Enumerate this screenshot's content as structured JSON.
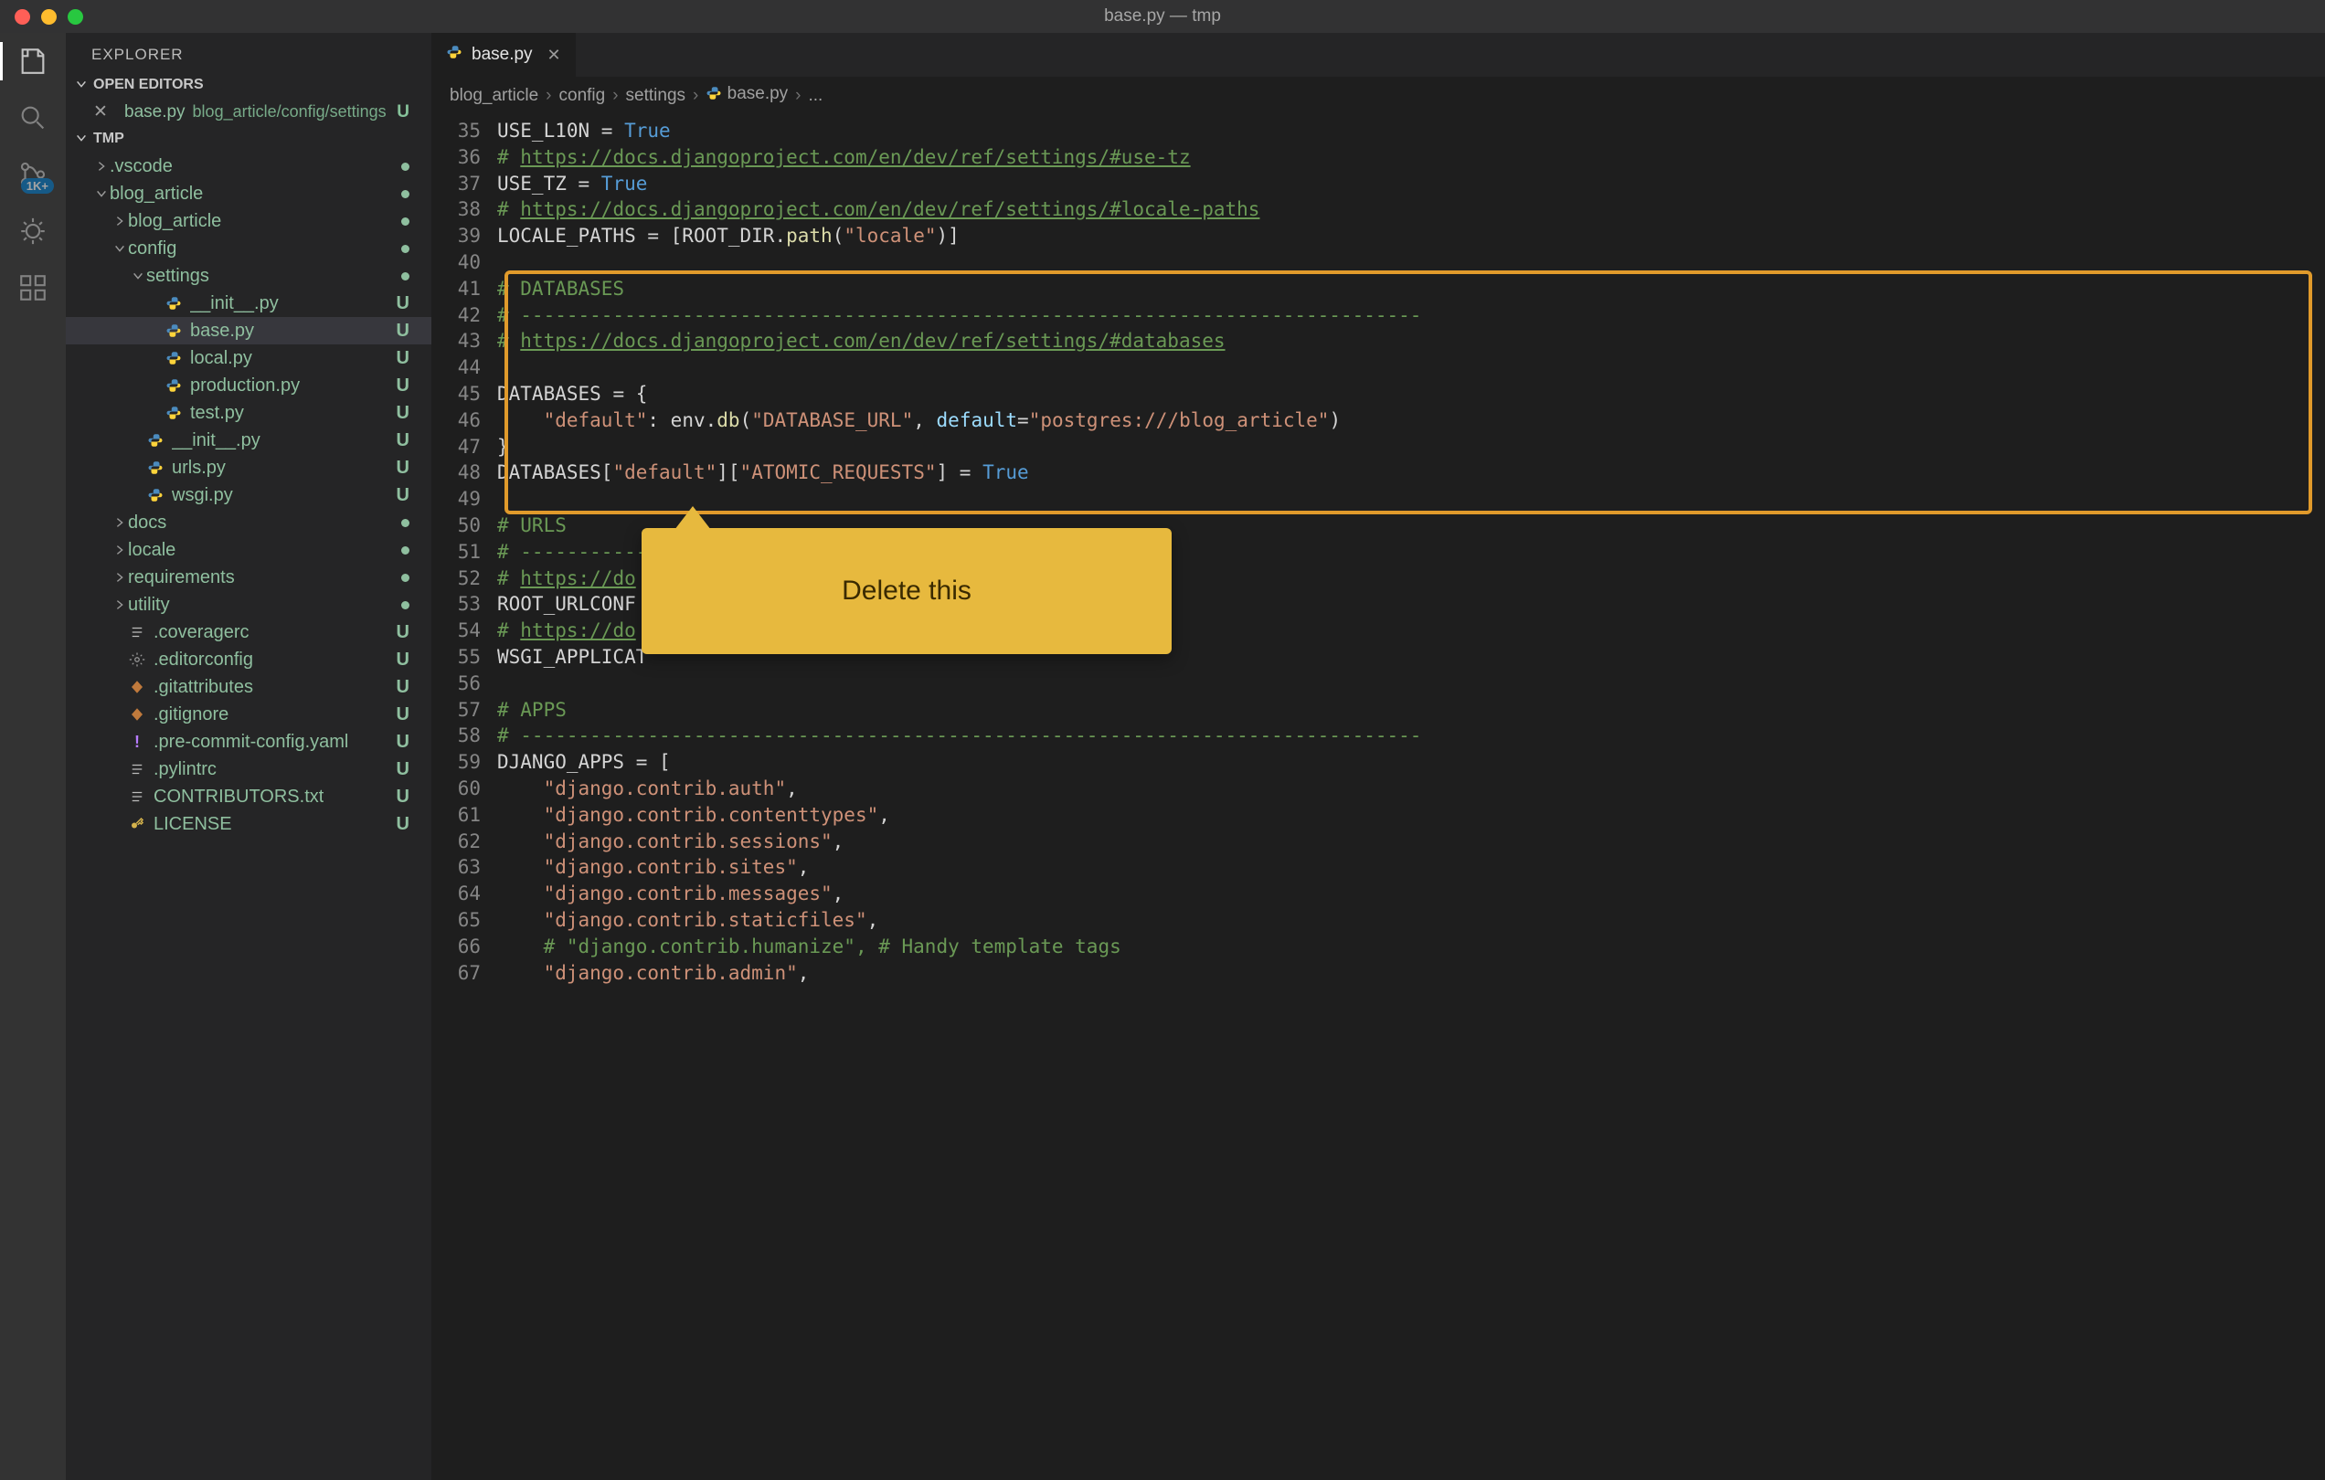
{
  "window_title": "base.py — tmp",
  "activity_badge": "1K+",
  "explorer": {
    "title": "EXPLORER",
    "open_editors_label": "OPEN EDITORS",
    "workspace_label": "TMP",
    "open_editor": {
      "name": "base.py",
      "path": "blog_article/config/settings",
      "status": "U"
    }
  },
  "tree": [
    {
      "depth": 1,
      "type": "folder",
      "open": false,
      "name": ".vscode",
      "status": "dot"
    },
    {
      "depth": 1,
      "type": "folder",
      "open": true,
      "name": "blog_article",
      "status": "dot"
    },
    {
      "depth": 2,
      "type": "folder",
      "open": false,
      "name": "blog_article",
      "status": "dot"
    },
    {
      "depth": 2,
      "type": "folder",
      "open": true,
      "name": "config",
      "status": "dot"
    },
    {
      "depth": 3,
      "type": "folder",
      "open": true,
      "name": "settings",
      "status": "dot"
    },
    {
      "depth": 4,
      "type": "file",
      "icon": "python",
      "name": "__init__.py",
      "status": "U"
    },
    {
      "depth": 4,
      "type": "file",
      "icon": "python",
      "name": "base.py",
      "status": "U",
      "selected": true
    },
    {
      "depth": 4,
      "type": "file",
      "icon": "python",
      "name": "local.py",
      "status": "U"
    },
    {
      "depth": 4,
      "type": "file",
      "icon": "python",
      "name": "production.py",
      "status": "U"
    },
    {
      "depth": 4,
      "type": "file",
      "icon": "python",
      "name": "test.py",
      "status": "U"
    },
    {
      "depth": 3,
      "type": "file",
      "icon": "python",
      "name": "__init__.py",
      "status": "U"
    },
    {
      "depth": 3,
      "type": "file",
      "icon": "python",
      "name": "urls.py",
      "status": "U"
    },
    {
      "depth": 3,
      "type": "file",
      "icon": "python",
      "name": "wsgi.py",
      "status": "U"
    },
    {
      "depth": 2,
      "type": "folder",
      "open": false,
      "name": "docs",
      "status": "dot"
    },
    {
      "depth": 2,
      "type": "folder",
      "open": false,
      "name": "locale",
      "status": "dot"
    },
    {
      "depth": 2,
      "type": "folder",
      "open": false,
      "name": "requirements",
      "status": "dot"
    },
    {
      "depth": 2,
      "type": "folder",
      "open": false,
      "name": "utility",
      "status": "dot"
    },
    {
      "depth": 2,
      "type": "file",
      "icon": "lines",
      "name": ".coveragerc",
      "status": "U"
    },
    {
      "depth": 2,
      "type": "file",
      "icon": "gear",
      "name": ".editorconfig",
      "status": "U"
    },
    {
      "depth": 2,
      "type": "file",
      "icon": "diamond",
      "name": ".gitattributes",
      "status": "U"
    },
    {
      "depth": 2,
      "type": "file",
      "icon": "diamond",
      "name": ".gitignore",
      "status": "U"
    },
    {
      "depth": 2,
      "type": "file",
      "icon": "bang",
      "name": ".pre-commit-config.yaml",
      "status": "U"
    },
    {
      "depth": 2,
      "type": "file",
      "icon": "lines",
      "name": ".pylintrc",
      "status": "U"
    },
    {
      "depth": 2,
      "type": "file",
      "icon": "lines",
      "name": "CONTRIBUTORS.txt",
      "status": "U"
    },
    {
      "depth": 2,
      "type": "file",
      "icon": "key",
      "name": "LICENSE",
      "status": "U"
    }
  ],
  "tab": {
    "name": "base.py"
  },
  "breadcrumbs": [
    "blog_article",
    "config",
    "settings",
    "base.py",
    "..."
  ],
  "editor": {
    "first_line": 35,
    "lines": [
      [
        {
          "t": "USE_L10N",
          "c": "var"
        },
        {
          "t": " = ",
          "c": "op"
        },
        {
          "t": "True",
          "c": "const"
        }
      ],
      [
        {
          "t": "# ",
          "c": "comment"
        },
        {
          "t": "https://docs.djangoproject.com/en/dev/ref/settings/#use-tz",
          "c": "link"
        }
      ],
      [
        {
          "t": "USE_TZ",
          "c": "var"
        },
        {
          "t": " = ",
          "c": "op"
        },
        {
          "t": "True",
          "c": "const"
        }
      ],
      [
        {
          "t": "# ",
          "c": "comment"
        },
        {
          "t": "https://docs.djangoproject.com/en/dev/ref/settings/#locale-paths",
          "c": "link"
        }
      ],
      [
        {
          "t": "LOCALE_PATHS",
          "c": "var"
        },
        {
          "t": " = [",
          "c": "punc"
        },
        {
          "t": "ROOT_DIR",
          "c": "var"
        },
        {
          "t": ".",
          "c": "punc"
        },
        {
          "t": "path",
          "c": "func"
        },
        {
          "t": "(",
          "c": "punc"
        },
        {
          "t": "\"locale\"",
          "c": "str"
        },
        {
          "t": ")]",
          "c": "punc"
        }
      ],
      [],
      [
        {
          "t": "# DATABASES",
          "c": "comment"
        }
      ],
      [
        {
          "t": "# ------------------------------------------------------------------------------",
          "c": "comment"
        }
      ],
      [
        {
          "t": "# ",
          "c": "comment"
        },
        {
          "t": "https://docs.djangoproject.com/en/dev/ref/settings/#databases",
          "c": "link"
        }
      ],
      [],
      [
        {
          "t": "DATABASES",
          "c": "var"
        },
        {
          "t": " = {",
          "c": "punc"
        }
      ],
      [
        {
          "t": "    ",
          "c": "var"
        },
        {
          "t": "\"default\"",
          "c": "str"
        },
        {
          "t": ": ",
          "c": "punc"
        },
        {
          "t": "env",
          "c": "var"
        },
        {
          "t": ".",
          "c": "punc"
        },
        {
          "t": "db",
          "c": "func"
        },
        {
          "t": "(",
          "c": "punc"
        },
        {
          "t": "\"DATABASE_URL\"",
          "c": "str"
        },
        {
          "t": ", ",
          "c": "punc"
        },
        {
          "t": "default",
          "c": "param"
        },
        {
          "t": "=",
          "c": "op"
        },
        {
          "t": "\"postgres:///blog_article\"",
          "c": "str"
        },
        {
          "t": ")",
          "c": "punc"
        }
      ],
      [
        {
          "t": "}",
          "c": "punc"
        }
      ],
      [
        {
          "t": "DATABASES",
          "c": "var"
        },
        {
          "t": "[",
          "c": "punc"
        },
        {
          "t": "\"default\"",
          "c": "str"
        },
        {
          "t": "][",
          "c": "punc"
        },
        {
          "t": "\"ATOMIC_REQUESTS\"",
          "c": "str"
        },
        {
          "t": "]",
          "c": "punc"
        },
        {
          "t": " = ",
          "c": "op"
        },
        {
          "t": "True",
          "c": "const"
        }
      ],
      [],
      [
        {
          "t": "# URLS",
          "c": "comment"
        }
      ],
      [
        {
          "t": "# -----------",
          "c": "comment"
        }
      ],
      [
        {
          "t": "# ",
          "c": "comment"
        },
        {
          "t": "https://do",
          "c": "link"
        }
      ],
      [
        {
          "t": "ROOT_URLCONF ",
          "c": "var"
        }
      ],
      [
        {
          "t": "# ",
          "c": "comment"
        },
        {
          "t": "https://do",
          "c": "link"
        }
      ],
      [
        {
          "t": "WSGI_APPLICAT",
          "c": "var"
        }
      ],
      [],
      [
        {
          "t": "# APPS",
          "c": "comment"
        }
      ],
      [
        {
          "t": "# ------------------------------------------------------------------------------",
          "c": "comment"
        }
      ],
      [
        {
          "t": "DJANGO_APPS",
          "c": "var"
        },
        {
          "t": " = [",
          "c": "punc"
        }
      ],
      [
        {
          "t": "    ",
          "c": "var"
        },
        {
          "t": "\"django.contrib.auth\"",
          "c": "str"
        },
        {
          "t": ",",
          "c": "punc"
        }
      ],
      [
        {
          "t": "    ",
          "c": "var"
        },
        {
          "t": "\"django.contrib.contenttypes\"",
          "c": "str"
        },
        {
          "t": ",",
          "c": "punc"
        }
      ],
      [
        {
          "t": "    ",
          "c": "var"
        },
        {
          "t": "\"django.contrib.sessions\"",
          "c": "str"
        },
        {
          "t": ",",
          "c": "punc"
        }
      ],
      [
        {
          "t": "    ",
          "c": "var"
        },
        {
          "t": "\"django.contrib.sites\"",
          "c": "str"
        },
        {
          "t": ",",
          "c": "punc"
        }
      ],
      [
        {
          "t": "    ",
          "c": "var"
        },
        {
          "t": "\"django.contrib.messages\"",
          "c": "str"
        },
        {
          "t": ",",
          "c": "punc"
        }
      ],
      [
        {
          "t": "    ",
          "c": "var"
        },
        {
          "t": "\"django.contrib.staticfiles\"",
          "c": "str"
        },
        {
          "t": ",",
          "c": "punc"
        }
      ],
      [
        {
          "t": "    ",
          "c": "var"
        },
        {
          "t": "# \"django.contrib.humanize\", # Handy template tags",
          "c": "comment"
        }
      ],
      [
        {
          "t": "    ",
          "c": "var"
        },
        {
          "t": "\"django.contrib.admin\"",
          "c": "str"
        },
        {
          "t": ",",
          "c": "punc"
        }
      ]
    ]
  },
  "annotation": {
    "box": {
      "from_line": 41,
      "to_line": 49
    },
    "callout_text": "Delete this"
  },
  "colors": {
    "accent": "#e7b93e",
    "box": "#e09a2b",
    "green": "#8fbf9f"
  }
}
